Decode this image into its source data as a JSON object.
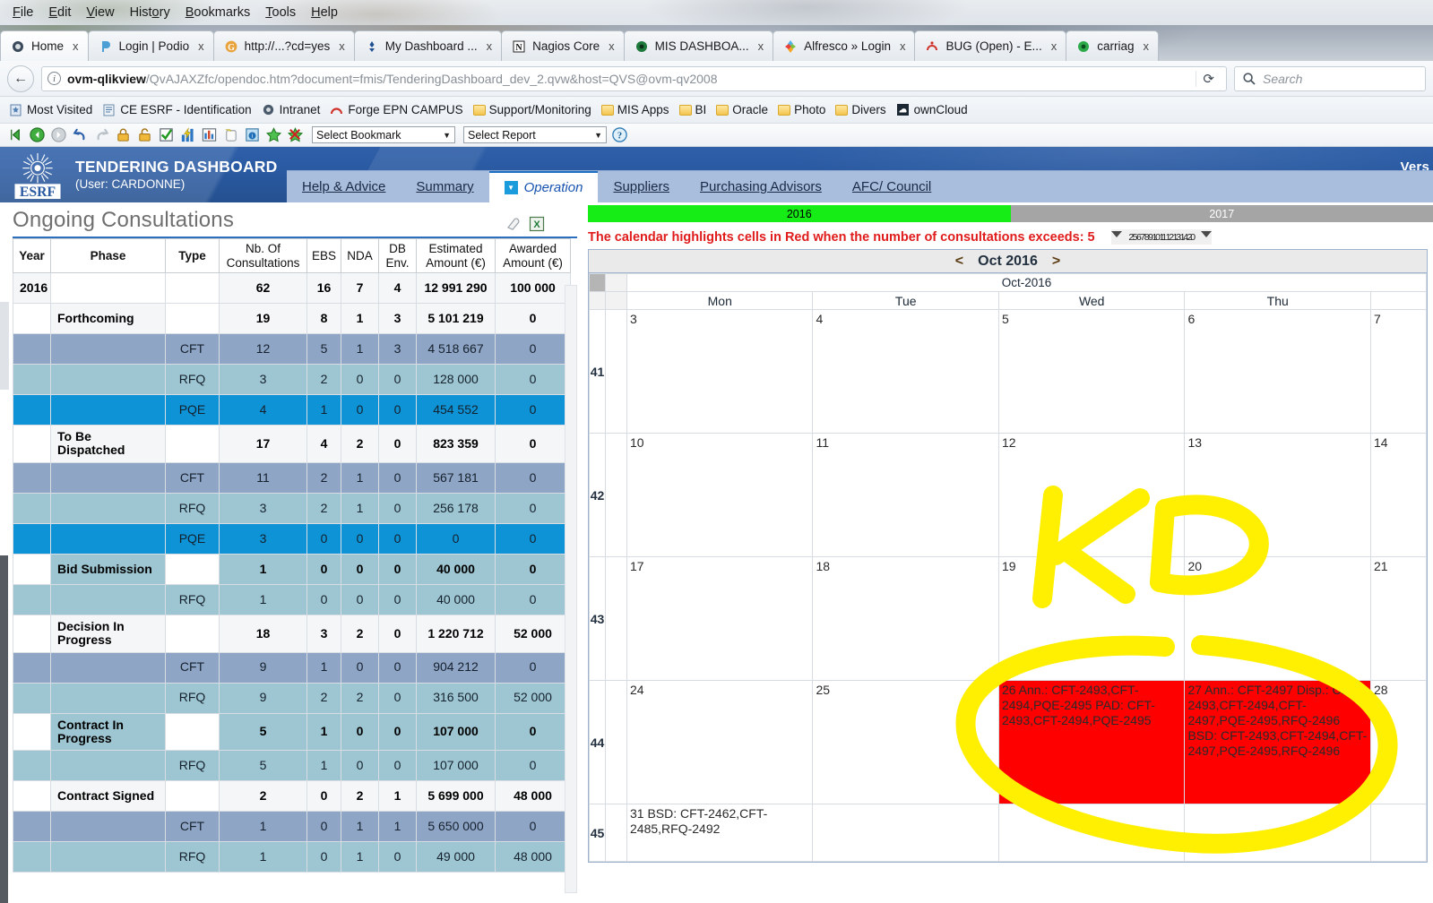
{
  "browser": {
    "menus": [
      "File",
      "Edit",
      "View",
      "History",
      "Bookmarks",
      "Tools",
      "Help"
    ],
    "tabs": [
      {
        "label": "Home",
        "icon": "home-favicon",
        "active": true
      },
      {
        "label": "Login | Podio",
        "icon": "podio-favicon",
        "active": false
      },
      {
        "label": "http://...?cd=yes",
        "icon": "google-favicon",
        "active": false
      },
      {
        "label": "My Dashboard ...",
        "icon": "dashboard-favicon",
        "active": false
      },
      {
        "label": "Nagios Core",
        "icon": "nagios-favicon",
        "active": false
      },
      {
        "label": "MIS DASHBOA...",
        "icon": "mis-favicon",
        "active": false
      },
      {
        "label": "Alfresco » Login",
        "icon": "alfresco-favicon",
        "active": false
      },
      {
        "label": "BUG (Open) - E...",
        "icon": "bug-favicon",
        "active": false
      },
      {
        "label": "carriag",
        "icon": "carriage-favicon",
        "active": false
      }
    ],
    "tab_close_label": "x",
    "url_host": "ovm-qlikview",
    "url_path": "/QvAJAXZfc/opendoc.htm?document=fmis/TenderingDashboard_dev_2.qvw&host=QVS@ovm-qv2008",
    "search_placeholder": "Search",
    "reload_glyph": "⟳",
    "back_glyph": "←",
    "bookmarks": [
      {
        "label": "Most Visited",
        "icon": "star-page-icon"
      },
      {
        "label": "CE ESRF - Identification",
        "icon": "page-icon"
      },
      {
        "label": "Intranet",
        "icon": "intranet-icon"
      },
      {
        "label": "Forge EPN CAMPUS",
        "icon": "forge-icon"
      },
      {
        "label": "Support/Monitoring",
        "icon": "folder-icon"
      },
      {
        "label": "MIS Apps",
        "icon": "folder-icon"
      },
      {
        "label": "BI",
        "icon": "folder-icon"
      },
      {
        "label": "Oracle",
        "icon": "folder-icon"
      },
      {
        "label": "Photo",
        "icon": "folder-icon"
      },
      {
        "label": "Divers",
        "icon": "folder-icon"
      },
      {
        "label": "ownCloud",
        "icon": "owncloud-icon"
      }
    ],
    "qv_toolbar": {
      "select_bookmark": "Select Bookmark",
      "select_report": "Select Report",
      "caret": "▼",
      "icons": [
        "clear-all-icon",
        "back-icon",
        "forward-icon",
        "undo-icon",
        "redo-icon",
        "lock-icon",
        "unlock-icon",
        "check-icon",
        "chart-icon",
        "report-icon",
        "copy-icon",
        "info-icon",
        "add-bookmark-icon",
        "remove-bookmark-icon",
        "help-icon"
      ]
    }
  },
  "app": {
    "brand_title": "TENDERING DASHBOARD",
    "brand_user": "(User: CARDONNE)",
    "logo_alt": "ESRF",
    "version_label": "Vers",
    "tabs": [
      {
        "label": "Help & Advice",
        "selected": false
      },
      {
        "label": "Summary",
        "selected": false
      },
      {
        "label": "Operation",
        "selected": true
      },
      {
        "label": "Suppliers",
        "selected": false
      },
      {
        "label": "Purchasing Advisors",
        "selected": false
      },
      {
        "label": "AFC/ Council",
        "selected": false
      }
    ]
  },
  "left": {
    "title": "Ongoing Consultations",
    "tools": [
      "eraser-icon",
      "excel-export-icon"
    ],
    "columns": [
      "Year",
      "Phase",
      "Type",
      "Nb. Of Consultations",
      "EBS",
      "NDA",
      "DB Env.",
      "Estimated Amount (€)",
      "Awarded Amount (€)"
    ],
    "rows": [
      {
        "kind": "total",
        "year": "2016",
        "phase": "",
        "type": "",
        "nb": "62",
        "ebs": "16",
        "nda": "7",
        "db": "4",
        "est": "12 991 290",
        "awa": "100 000"
      },
      {
        "kind": "phase",
        "year": "",
        "phase": "Forthcoming",
        "type": "",
        "nb": "19",
        "ebs": "8",
        "nda": "1",
        "db": "3",
        "est": "5 101 219",
        "awa": "0"
      },
      {
        "kind": "cft",
        "year": "",
        "phase": "",
        "type": "CFT",
        "nb": "12",
        "ebs": "5",
        "nda": "1",
        "db": "3",
        "est": "4 518 667",
        "awa": "0"
      },
      {
        "kind": "rfq",
        "year": "",
        "phase": "",
        "type": "RFQ",
        "nb": "3",
        "ebs": "2",
        "nda": "0",
        "db": "0",
        "est": "128 000",
        "awa": "0"
      },
      {
        "kind": "pqe",
        "year": "",
        "phase": "",
        "type": "PQE",
        "nb": "4",
        "ebs": "1",
        "nda": "0",
        "db": "0",
        "est": "454 552",
        "awa": "0"
      },
      {
        "kind": "phase",
        "year": "",
        "phase": "To Be Dispatched",
        "type": "",
        "nb": "17",
        "ebs": "4",
        "nda": "2",
        "db": "0",
        "est": "823 359",
        "awa": "0"
      },
      {
        "kind": "cft",
        "year": "",
        "phase": "",
        "type": "CFT",
        "nb": "11",
        "ebs": "2",
        "nda": "1",
        "db": "0",
        "est": "567 181",
        "awa": "0"
      },
      {
        "kind": "rfq",
        "year": "",
        "phase": "",
        "type": "RFQ",
        "nb": "3",
        "ebs": "2",
        "nda": "1",
        "db": "0",
        "est": "256 178",
        "awa": "0"
      },
      {
        "kind": "pqe",
        "year": "",
        "phase": "",
        "type": "PQE",
        "nb": "3",
        "ebs": "0",
        "nda": "0",
        "db": "0",
        "est": "0",
        "awa": "0"
      },
      {
        "kind": "phase_teal",
        "year": "",
        "phase": "Bid Submission",
        "type": "",
        "nb": "1",
        "ebs": "0",
        "nda": "0",
        "db": "0",
        "est": "40 000",
        "awa": "0"
      },
      {
        "kind": "rfq",
        "year": "",
        "phase": "",
        "type": "RFQ",
        "nb": "1",
        "ebs": "0",
        "nda": "0",
        "db": "0",
        "est": "40 000",
        "awa": "0"
      },
      {
        "kind": "phase",
        "year": "",
        "phase": "Decision In Progress",
        "type": "",
        "nb": "18",
        "ebs": "3",
        "nda": "2",
        "db": "0",
        "est": "1 220 712",
        "awa": "52 000"
      },
      {
        "kind": "cft",
        "year": "",
        "phase": "",
        "type": "CFT",
        "nb": "9",
        "ebs": "1",
        "nda": "0",
        "db": "0",
        "est": "904 212",
        "awa": "0"
      },
      {
        "kind": "rfq",
        "year": "",
        "phase": "",
        "type": "RFQ",
        "nb": "9",
        "ebs": "2",
        "nda": "2",
        "db": "0",
        "est": "316 500",
        "awa": "52 000"
      },
      {
        "kind": "phase_teal",
        "year": "",
        "phase": "Contract In Progress",
        "type": "",
        "nb": "5",
        "ebs": "1",
        "nda": "0",
        "db": "0",
        "est": "107 000",
        "awa": "0"
      },
      {
        "kind": "rfq",
        "year": "",
        "phase": "",
        "type": "RFQ",
        "nb": "5",
        "ebs": "1",
        "nda": "0",
        "db": "0",
        "est": "107 000",
        "awa": "0"
      },
      {
        "kind": "phase",
        "year": "",
        "phase": "Contract Signed",
        "type": "",
        "nb": "2",
        "ebs": "0",
        "nda": "2",
        "db": "1",
        "est": "5 699 000",
        "awa": "48 000"
      },
      {
        "kind": "cft",
        "year": "",
        "phase": "",
        "type": "CFT",
        "nb": "1",
        "ebs": "0",
        "nda": "1",
        "db": "1",
        "est": "5 650 000",
        "awa": "0"
      },
      {
        "kind": "rfq",
        "year": "",
        "phase": "",
        "type": "RFQ",
        "nb": "1",
        "ebs": "0",
        "nda": "1",
        "db": "0",
        "est": "49 000",
        "awa": "48 000"
      }
    ]
  },
  "right": {
    "years": [
      {
        "label": "2016",
        "state": "active"
      },
      {
        "label": "2017",
        "state": "inactive"
      }
    ],
    "hint": "The calendar highlights cells in Red when the number of consultations exceeds: 5",
    "slider_value": "2 5 6 7 8 9 10 11 12 13 14 20",
    "calendar": {
      "prev": "<",
      "next": ">",
      "month_nav_label": "Oct 2016",
      "month_label": "Oct-2016",
      "dow": [
        "Mon",
        "Tue",
        "Wed",
        "Thu",
        ""
      ],
      "weeks": [
        {
          "wk": "41",
          "days": [
            {
              "d": "3",
              "text": "",
              "red": false
            },
            {
              "d": "4",
              "text": "",
              "red": false
            },
            {
              "d": "5",
              "text": "",
              "red": false
            },
            {
              "d": "6",
              "text": "",
              "red": false
            },
            {
              "d": "7",
              "text": "",
              "red": false
            }
          ]
        },
        {
          "wk": "42",
          "days": [
            {
              "d": "10",
              "text": "",
              "red": false
            },
            {
              "d": "11",
              "text": "",
              "red": false
            },
            {
              "d": "12",
              "text": "",
              "red": false
            },
            {
              "d": "13",
              "text": "",
              "red": false
            },
            {
              "d": "14",
              "text": "",
              "red": false
            }
          ]
        },
        {
          "wk": "43",
          "days": [
            {
              "d": "17",
              "text": "",
              "red": false
            },
            {
              "d": "18",
              "text": "",
              "red": false
            },
            {
              "d": "19",
              "text": "",
              "red": false
            },
            {
              "d": "20",
              "text": "",
              "red": false
            },
            {
              "d": "21",
              "text": "",
              "red": false
            }
          ]
        },
        {
          "wk": "44",
          "days": [
            {
              "d": "24",
              "text": "",
              "red": false
            },
            {
              "d": "25",
              "text": "",
              "red": false
            },
            {
              "d": "26",
              "text": "Ann.: CFT-2493,CFT-2494,PQE-2495  PAD: CFT-2493,CFT-2494,PQE-2495",
              "red": true
            },
            {
              "d": "27",
              "text": "Ann.: CFT-2497  Disp.: CFT-2493,CFT-2494,CFT-2497,PQE-2495,RFQ-2496  BSD: CFT-2493,CFT-2494,CFT-2497,PQE-2495,RFQ-2496",
              "red": true
            },
            {
              "d": "28",
              "text": "",
              "red": false
            }
          ]
        },
        {
          "wk": "45",
          "days": [
            {
              "d": "31",
              "text": "BSD: CFT-2462,CFT-2485,RFQ-2492",
              "red": false
            },
            {
              "d": "",
              "text": "",
              "red": false
            },
            {
              "d": "",
              "text": "",
              "red": false
            },
            {
              "d": "",
              "text": "",
              "red": false
            },
            {
              "d": "",
              "text": "",
              "red": false
            }
          ]
        }
      ]
    }
  },
  "annotation": {
    "shapes": [
      "handwritten-K",
      "handwritten-D",
      "handwritten-ellipse"
    ],
    "color": "#ffef00"
  },
  "colors": {
    "app_blue": "#2a5aa2",
    "tab_bar": "#a9bedd",
    "selected_tab_text": "#1853b0",
    "cft_row": "#8fa5c6",
    "rfq_row": "#9dc6d2",
    "pqe_row": "#0d93d6",
    "year_active": "#16ec16",
    "year_inactive": "#a5a5a5",
    "alert_red": "#e01b1b",
    "cell_red": "#fe0000",
    "annotation_yellow": "#ffef00"
  }
}
